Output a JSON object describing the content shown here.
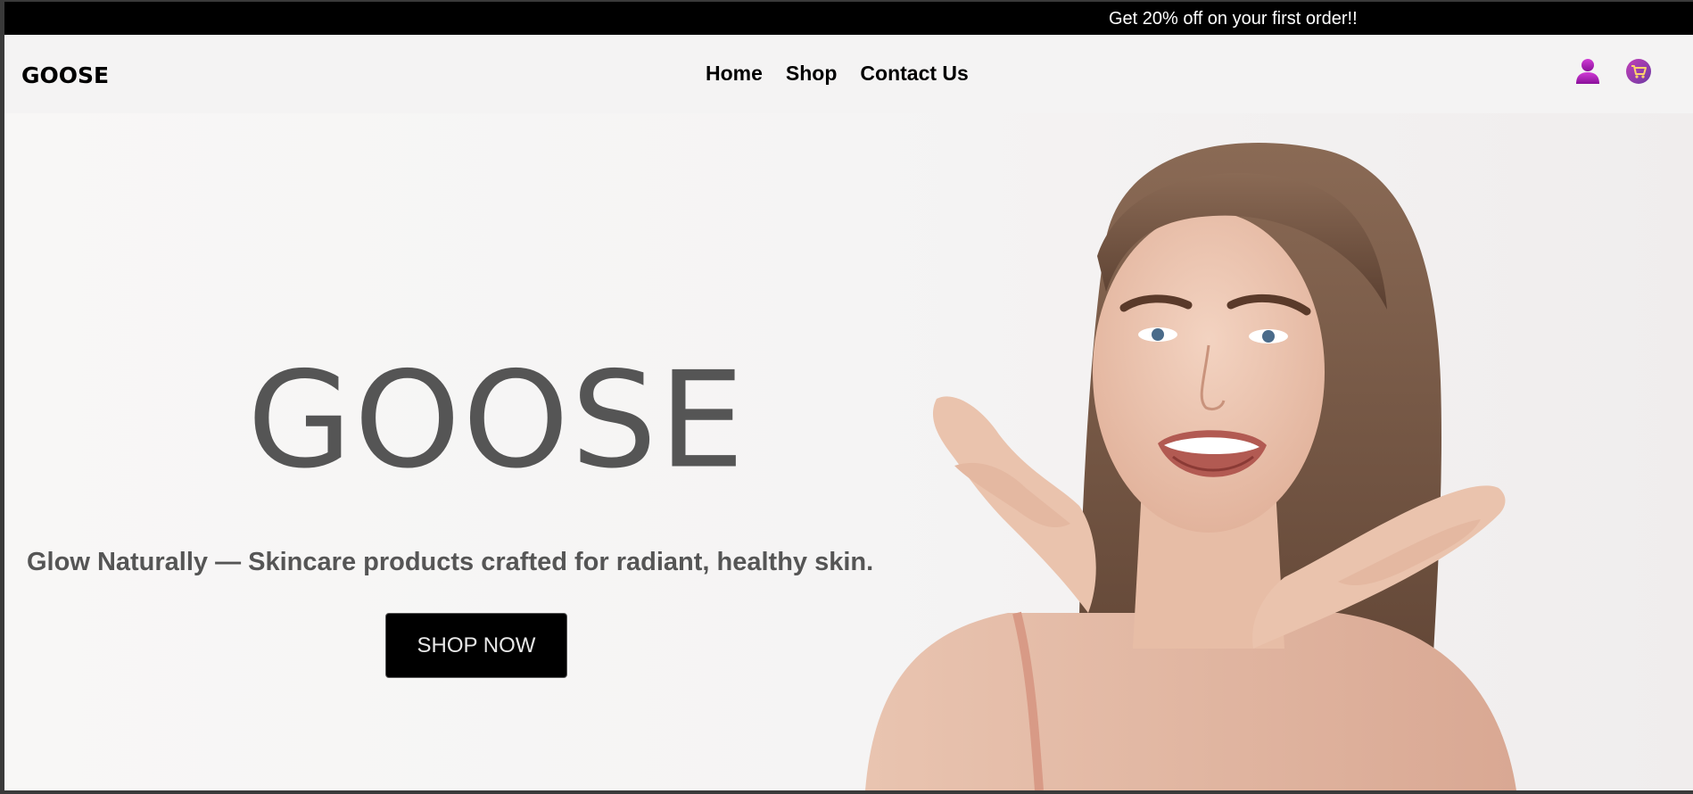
{
  "promo": {
    "text": "Get 20% off on your first order!!"
  },
  "header": {
    "brand": "GOOSE",
    "nav": [
      {
        "label": "Home"
      },
      {
        "label": "Shop"
      },
      {
        "label": "Contact Us"
      }
    ],
    "icons": {
      "account": "user-icon",
      "cart": "cart-icon"
    }
  },
  "hero": {
    "title": "GOOSE",
    "subtitle": "Glow Naturally — Skincare products crafted for radiant, healthy skin.",
    "cta_label": "SHOP NOW",
    "image": "smiling-woman-photo"
  },
  "colors": {
    "promo_bg": "#000000",
    "nav_bg": "#f4f3f3",
    "hero_text": "#555555",
    "cta_bg": "#000000",
    "icon_accent": "#b01fb6"
  }
}
